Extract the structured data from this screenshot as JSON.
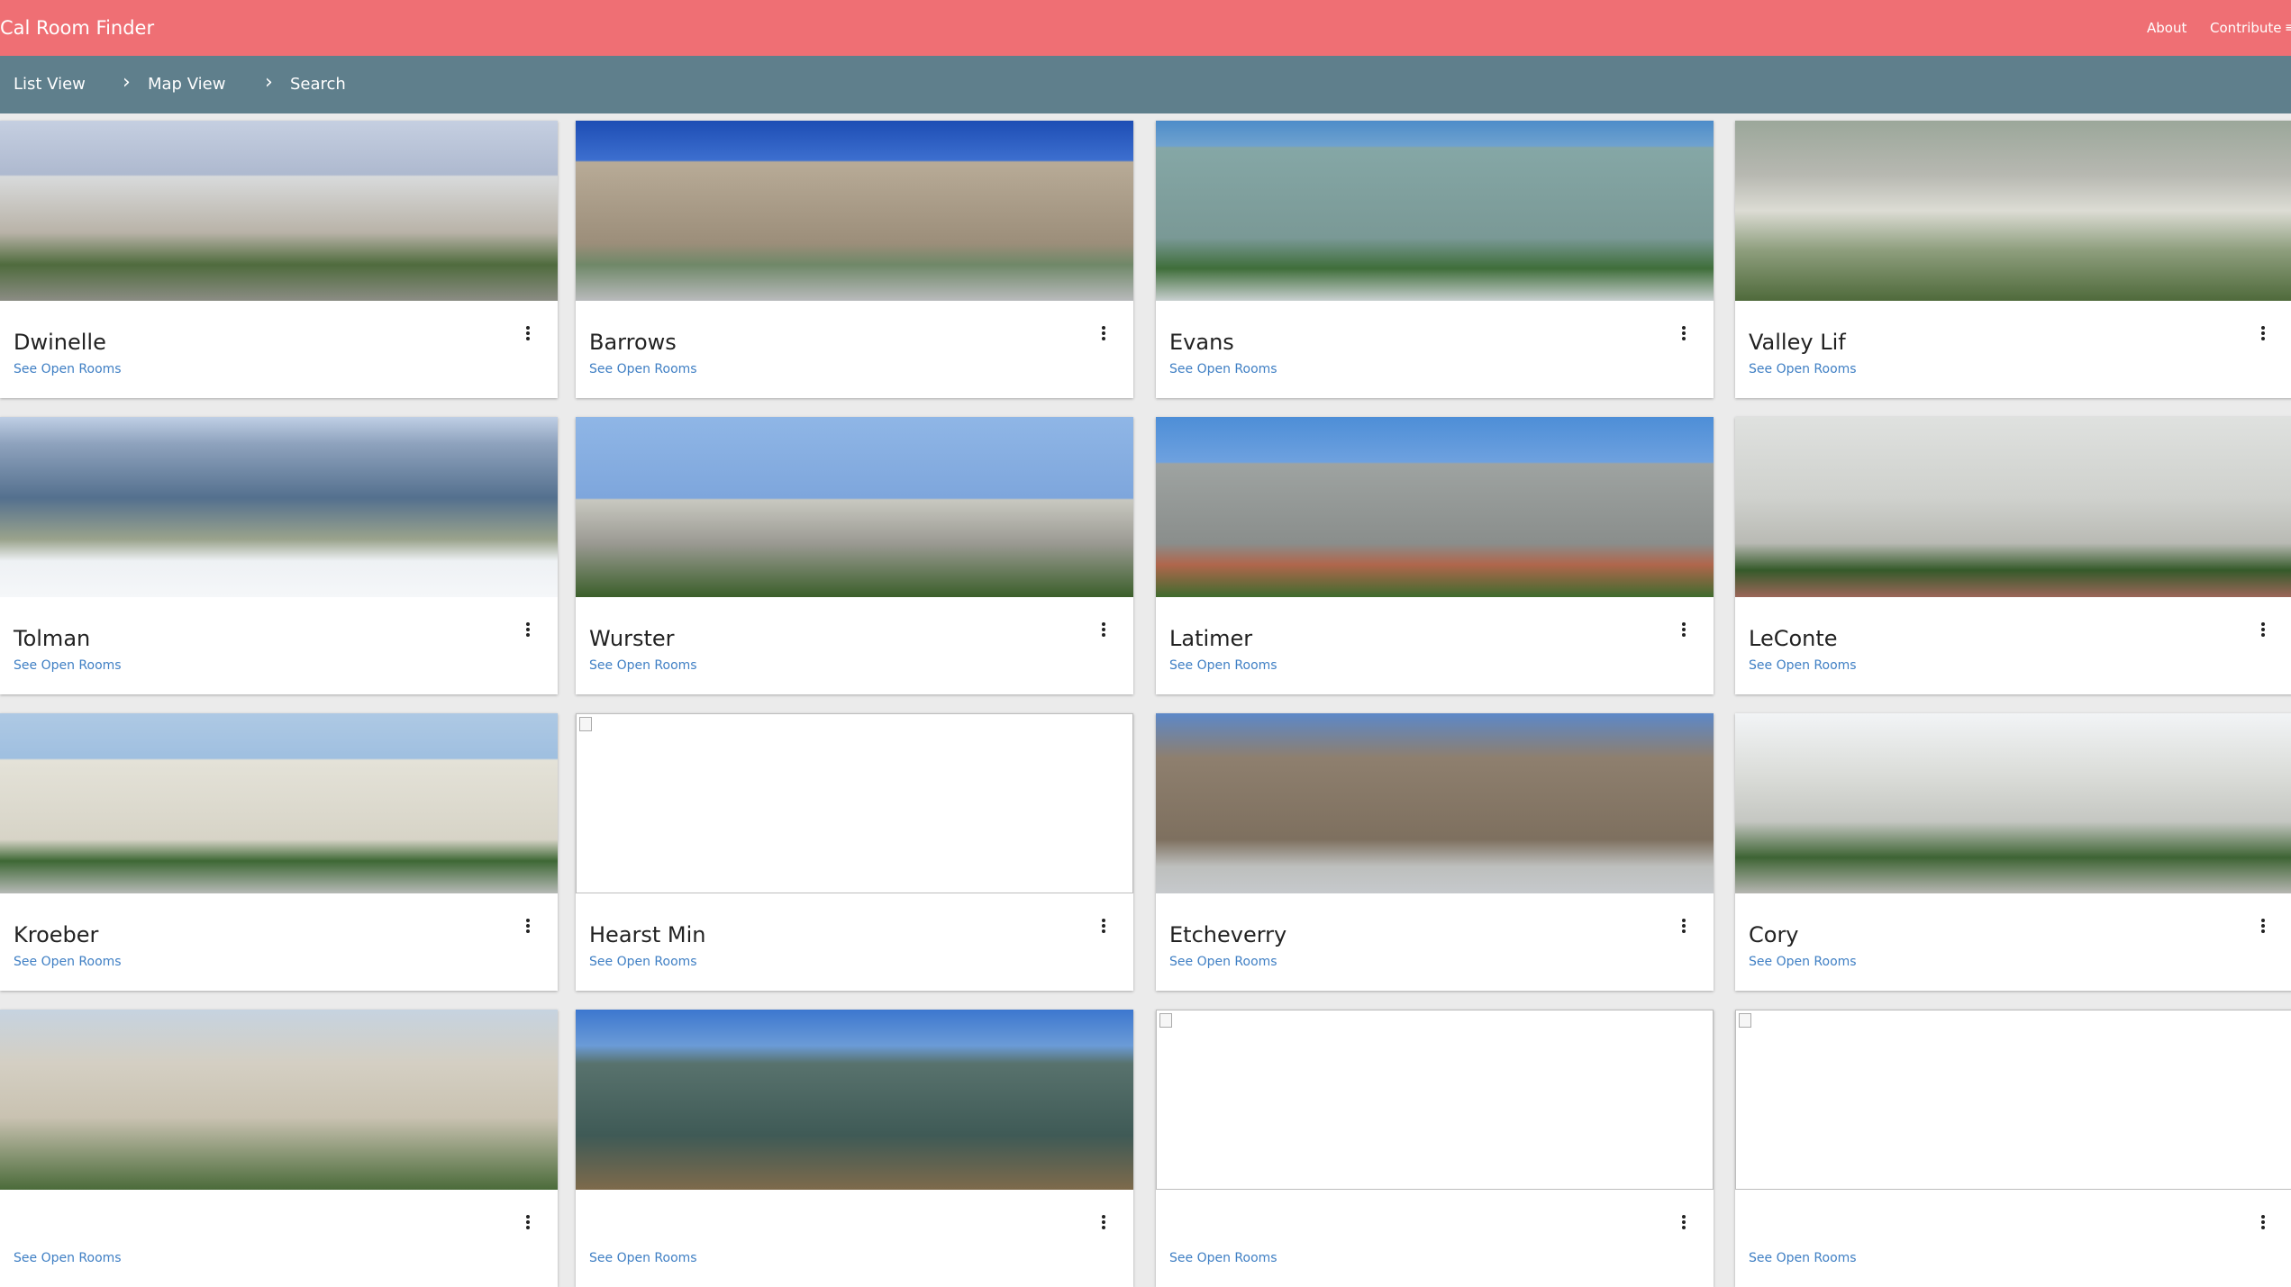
{
  "app": {
    "title": "Cal Room Finder"
  },
  "topnav": {
    "about": "About",
    "contribute": "Contribute",
    "more": "≡"
  },
  "subnav": {
    "items": [
      "List View",
      "Map View",
      "Search"
    ]
  },
  "card_link_label": "See Open Rooms",
  "buildings": [
    {
      "name": "Dwinelle",
      "has_image": true
    },
    {
      "name": "Barrows",
      "has_image": true
    },
    {
      "name": "Evans",
      "has_image": true
    },
    {
      "name": "Valley Lif",
      "has_image": true
    },
    {
      "name": "Tolman",
      "has_image": true
    },
    {
      "name": "Wurster",
      "has_image": true
    },
    {
      "name": "Latimer",
      "has_image": true
    },
    {
      "name": "LeConte",
      "has_image": true
    },
    {
      "name": "Kroeber",
      "has_image": true
    },
    {
      "name": "Hearst Min",
      "has_image": false
    },
    {
      "name": "Etcheverry",
      "has_image": true
    },
    {
      "name": "Cory",
      "has_image": true
    },
    {
      "name": "",
      "has_image": true
    },
    {
      "name": "",
      "has_image": true
    },
    {
      "name": "",
      "has_image": false
    },
    {
      "name": "",
      "has_image": false
    }
  ],
  "colors": {
    "topbar": "#ef6f74",
    "subnav": "#5f7f8c",
    "link": "#3f7fc4"
  }
}
